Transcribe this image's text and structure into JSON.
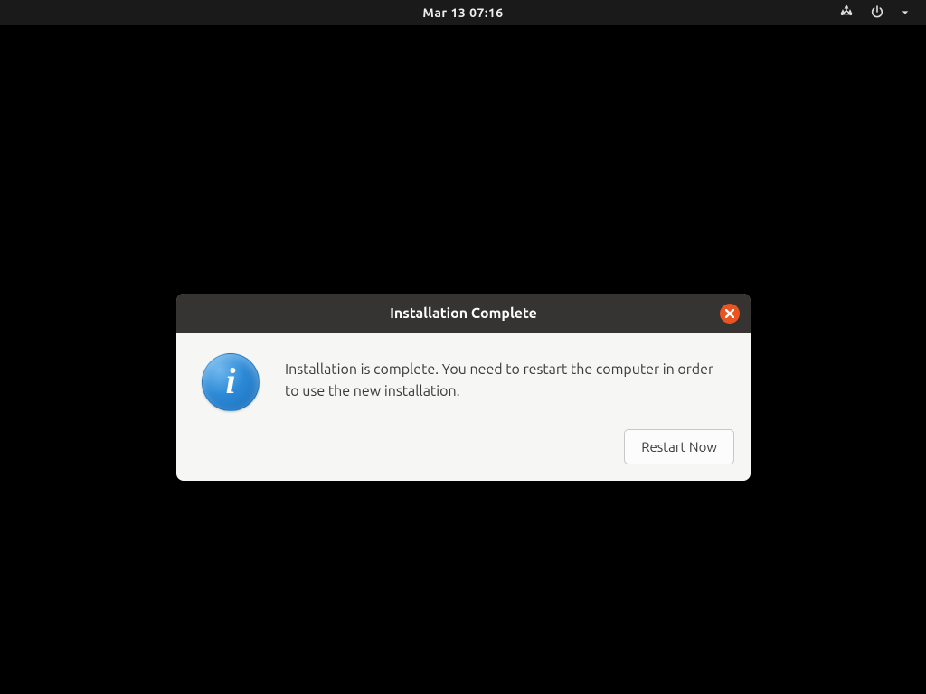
{
  "topbar": {
    "clock": "Mar 13  07:16"
  },
  "dialog": {
    "title": "Installation Complete",
    "message": "Installation is complete. You need to restart the computer in order to use the new installation.",
    "info_glyph": "i",
    "restart_label": "Restart Now"
  }
}
